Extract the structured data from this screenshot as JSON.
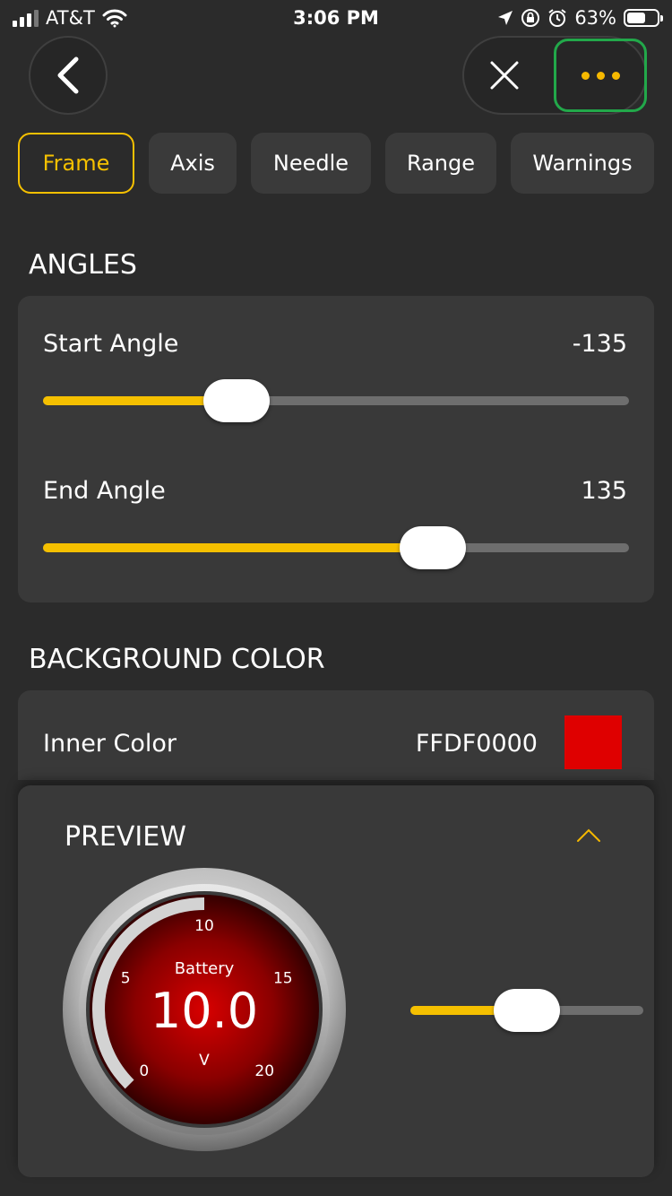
{
  "status_bar": {
    "carrier": "AT&T",
    "time": "3:06 PM",
    "battery": "63%",
    "battery_level": 0.63
  },
  "nav": {
    "back_icon": "chevron-left-icon",
    "close_icon": "close-icon",
    "more_icon": "more-horizontal-icon"
  },
  "tabs": [
    {
      "label": "Frame",
      "active": true
    },
    {
      "label": "Axis",
      "active": false
    },
    {
      "label": "Needle",
      "active": false
    },
    {
      "label": "Range",
      "active": false
    },
    {
      "label": "Warnings",
      "active": false
    }
  ],
  "angles": {
    "title": "ANGLES",
    "start": {
      "label": "Start Angle",
      "value": "-135",
      "fraction": 0.33
    },
    "end": {
      "label": "End Angle",
      "value": "135",
      "fraction": 0.665
    }
  },
  "background": {
    "title": "BACKGROUND COLOR",
    "inner": {
      "label": "Inner Color",
      "value": "FFDF0000",
      "swatch": "#df0000"
    }
  },
  "preview": {
    "title": "PREVIEW",
    "gauge": {
      "label": "Battery",
      "value": "10.0",
      "unit": "V",
      "ticks": [
        "0",
        "5",
        "10",
        "15",
        "20"
      ]
    },
    "slider_fraction": 0.5
  },
  "colors": {
    "accent": "#f5c000",
    "highlight": "#22a84a",
    "background": "#2b2b2b",
    "card": "#393939"
  }
}
